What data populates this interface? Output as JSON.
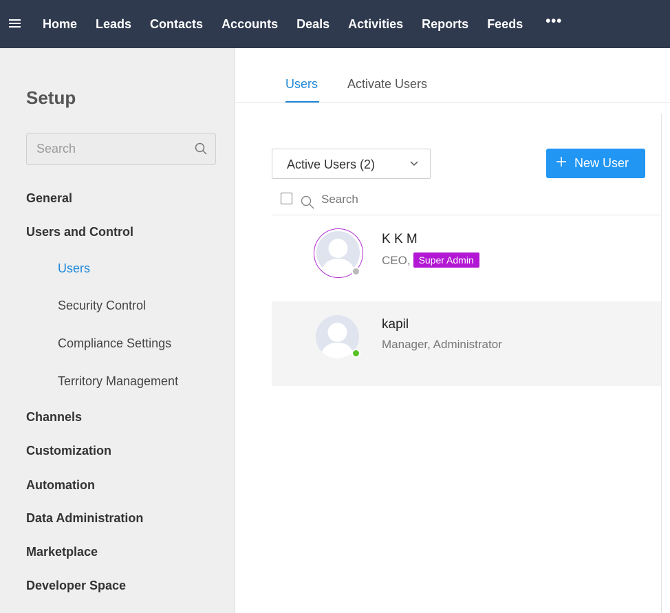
{
  "nav": {
    "items": [
      "Home",
      "Leads",
      "Contacts",
      "Accounts",
      "Deals",
      "Activities",
      "Reports",
      "Feeds"
    ],
    "more": "•••",
    "icons": {
      "menu": "hamburger-menu-icon",
      "more": "more-icon"
    }
  },
  "sidebar": {
    "title": "Setup",
    "search_placeholder": "Search",
    "items": {
      "general": "General",
      "users_and_control": "Users and Control",
      "users": "Users",
      "security_control": "Security Control",
      "compliance_settings": "Compliance Settings",
      "territory_management": "Territory Management",
      "channels": "Channels",
      "customization": "Customization",
      "automation": "Automation",
      "data_administration": "Data Administration",
      "marketplace": "Marketplace",
      "developer_space": "Developer Space"
    },
    "active_item": "Users"
  },
  "tabs": {
    "users": "Users",
    "activate_users": "Activate Users",
    "active": "Users"
  },
  "filter": {
    "selected": "Active Users (2)"
  },
  "new_user_button": "New User",
  "list": {
    "search_placeholder": "Search",
    "users": [
      {
        "name": "K K M",
        "role": "CEO,",
        "badge": "Super Admin",
        "status": "offline",
        "status_color": "#b9b9b9"
      },
      {
        "name": "kapil",
        "role": "Manager, Administrator",
        "status": "online",
        "status_color": "#57c126"
      }
    ]
  },
  "colors": {
    "nav_bg": "#2f3a4f",
    "accent": "#1e88d9",
    "button": "#2196f3",
    "badge": "#b217d4"
  }
}
